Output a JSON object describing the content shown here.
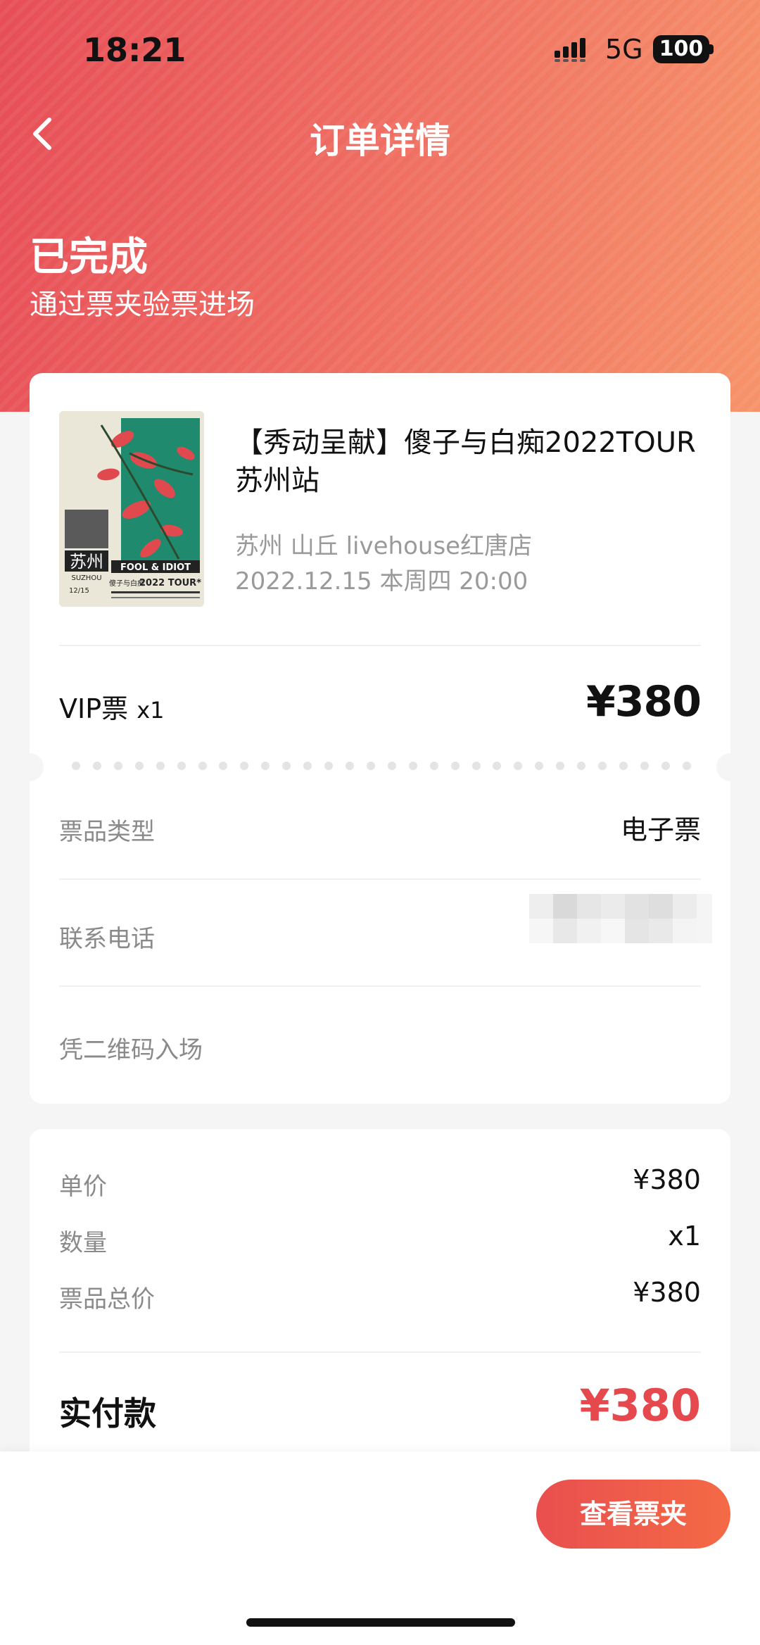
{
  "status_bar": {
    "time": "18:21",
    "network": "5G",
    "battery": "100"
  },
  "nav": {
    "title": "订单详情"
  },
  "order_status": {
    "title": "已完成",
    "subtitle": "通过票夹验票进场"
  },
  "event": {
    "title": "【秀动呈献】傻子与白痴2022TOUR 苏州站",
    "venue": "苏州 山丘 livehouse红唐店",
    "datetime": "2022.12.15 本周四 20:00",
    "poster": {
      "city": "苏州",
      "city_en": "SUZHOU",
      "band": "FOOL & IDIOT",
      "band_cn": "傻子与白痴",
      "tour": "2022 TOUR*",
      "date": "12/15"
    }
  },
  "ticket": {
    "name": "VIP票",
    "qty": "x1",
    "price": "¥380"
  },
  "details": {
    "type_label": "票品类型",
    "type_value": "电子票",
    "phone_label": "联系电话",
    "entry_label": "凭二维码入场"
  },
  "price_summary": {
    "unit_label": "单价",
    "unit_value": "¥380",
    "qty_label": "数量",
    "qty_value": "x1",
    "total_label": "票品总价",
    "total_value": "¥380",
    "paid_label": "实付款",
    "paid_value": "¥380"
  },
  "actions": {
    "view_wallet": "查看票夹"
  },
  "colors": {
    "accent": "#e5484d",
    "header_start": "#e74e58",
    "header_end": "#f6936a"
  }
}
